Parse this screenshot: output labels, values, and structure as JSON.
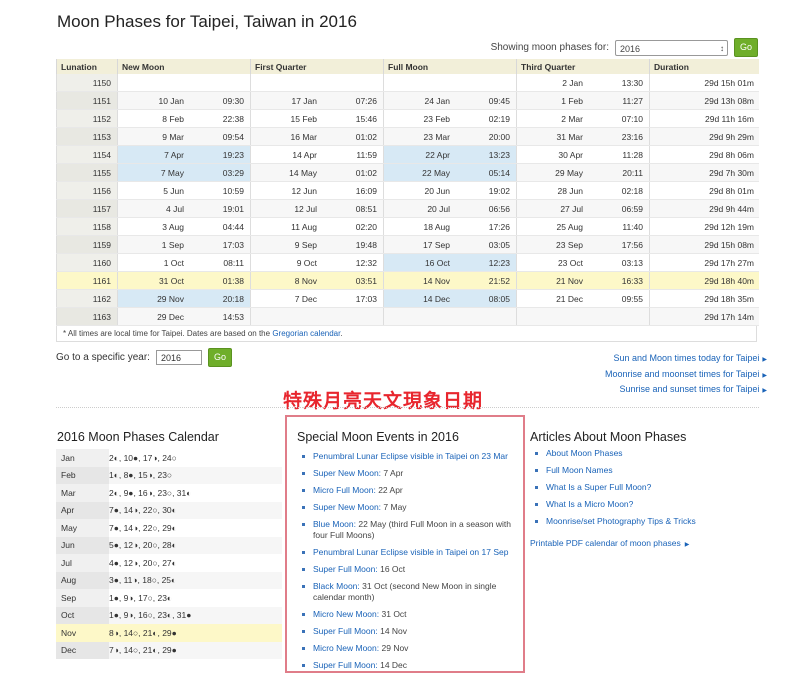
{
  "title": "Moon Phases for Taipei, Taiwan in 2016",
  "selector": {
    "label": "Showing moon phases for:",
    "value": "2016",
    "go": "Go"
  },
  "table": {
    "headers": [
      "Lunation",
      "New Moon",
      "First Quarter",
      "Full Moon",
      "Third Quarter",
      "Duration"
    ],
    "rows": [
      {
        "lun": "1150",
        "nm": [
          "",
          ""
        ],
        "fq": [
          "",
          ""
        ],
        "fm": [
          "",
          ""
        ],
        "tq": [
          "2 Jan",
          "13:30"
        ],
        "dur": "29d 15h 01m"
      },
      {
        "lun": "1151",
        "nm": [
          "10 Jan",
          "09:30"
        ],
        "fq": [
          "17 Jan",
          "07:26"
        ],
        "fm": [
          "24 Jan",
          "09:45"
        ],
        "tq": [
          "1 Feb",
          "11:27"
        ],
        "dur": "29d 13h 08m"
      },
      {
        "lun": "1152",
        "nm": [
          "8 Feb",
          "22:38"
        ],
        "fq": [
          "15 Feb",
          "15:46"
        ],
        "fm": [
          "23 Feb",
          "02:19"
        ],
        "tq": [
          "2 Mar",
          "07:10"
        ],
        "dur": "29d 11h 16m"
      },
      {
        "lun": "1153",
        "nm": [
          "9 Mar",
          "09:54"
        ],
        "fq": [
          "16 Mar",
          "01:02"
        ],
        "fm": [
          "23 Mar",
          "20:00"
        ],
        "tq": [
          "31 Mar",
          "23:16"
        ],
        "dur": "29d 9h 29m"
      },
      {
        "lun": "1154",
        "nm": [
          "7 Apr",
          "19:23"
        ],
        "fq": [
          "14 Apr",
          "11:59"
        ],
        "fm": [
          "22 Apr",
          "13:23"
        ],
        "tq": [
          "30 Apr",
          "11:28"
        ],
        "dur": "29d 8h 06m"
      },
      {
        "lun": "1155",
        "nm": [
          "7 May",
          "03:29"
        ],
        "fq": [
          "14 May",
          "01:02"
        ],
        "fm": [
          "22 May",
          "05:14"
        ],
        "tq": [
          "29 May",
          "20:11"
        ],
        "dur": "29d 7h 30m"
      },
      {
        "lun": "1156",
        "nm": [
          "5 Jun",
          "10:59"
        ],
        "fq": [
          "12 Jun",
          "16:09"
        ],
        "fm": [
          "20 Jun",
          "19:02"
        ],
        "tq": [
          "28 Jun",
          "02:18"
        ],
        "dur": "29d 8h 01m"
      },
      {
        "lun": "1157",
        "nm": [
          "4 Jul",
          "19:01"
        ],
        "fq": [
          "12 Jul",
          "08:51"
        ],
        "fm": [
          "20 Jul",
          "06:56"
        ],
        "tq": [
          "27 Jul",
          "06:59"
        ],
        "dur": "29d 9h 44m"
      },
      {
        "lun": "1158",
        "nm": [
          "3 Aug",
          "04:44"
        ],
        "fq": [
          "11 Aug",
          "02:20"
        ],
        "fm": [
          "18 Aug",
          "17:26"
        ],
        "tq": [
          "25 Aug",
          "11:40"
        ],
        "dur": "29d 12h 19m"
      },
      {
        "lun": "1159",
        "nm": [
          "1 Sep",
          "17:03"
        ],
        "fq": [
          "9 Sep",
          "19:48"
        ],
        "fm": [
          "17 Sep",
          "03:05"
        ],
        "tq": [
          "23 Sep",
          "17:56"
        ],
        "dur": "29d 15h 08m"
      },
      {
        "lun": "1160",
        "nm": [
          "1 Oct",
          "08:11"
        ],
        "fq": [
          "9 Oct",
          "12:32"
        ],
        "fm": [
          "16 Oct",
          "12:23"
        ],
        "tq": [
          "23 Oct",
          "03:13"
        ],
        "dur": "29d 17h 27m"
      },
      {
        "lun": "1161",
        "nm": [
          "31 Oct",
          "01:38"
        ],
        "fq": [
          "8 Nov",
          "03:51"
        ],
        "fm": [
          "14 Nov",
          "21:52"
        ],
        "tq": [
          "21 Nov",
          "16:33"
        ],
        "dur": "29d 18h 40m"
      },
      {
        "lun": "1162",
        "nm": [
          "29 Nov",
          "20:18"
        ],
        "fq": [
          "7 Dec",
          "17:03"
        ],
        "fm": [
          "14 Dec",
          "08:05"
        ],
        "tq": [
          "21 Dec",
          "09:55"
        ],
        "dur": "29d 18h 35m"
      },
      {
        "lun": "1163",
        "nm": [
          "29 Dec",
          "14:53"
        ],
        "fq": [
          "",
          ""
        ],
        "fm": [
          "",
          ""
        ],
        "tq": [
          "",
          ""
        ],
        "dur": "29d 17h 14m"
      }
    ]
  },
  "footnote": {
    "text": "* All times are local time for Taipei. Dates are based on the",
    "link": "Gregorian calendar",
    "end": "."
  },
  "goto": {
    "label": "Go to a specific year:",
    "value": "2016",
    "go": "Go"
  },
  "side_links": [
    "Sun and Moon times today for Taipei",
    "Moonrise and moonset times for Taipei",
    "Sunrise and sunset times for Taipei"
  ],
  "annotation": "特殊月亮天文現象日期",
  "calendar": {
    "title": "2016 Moon Phases Calendar",
    "rows": [
      {
        "month": "Jan",
        "text": "2◐, 10●, 17◑, 24○"
      },
      {
        "month": "Feb",
        "text": "1◐, 8●, 15◑, 23○"
      },
      {
        "month": "Mar",
        "text": "2◐, 9●, 16◑, 23○, 31◐"
      },
      {
        "month": "Apr",
        "text": "7●, 14◑, 22○, 30◐"
      },
      {
        "month": "May",
        "text": "7●, 14◑, 22○, 29◐"
      },
      {
        "month": "Jun",
        "text": "5●, 12◑, 20○, 28◐"
      },
      {
        "month": "Jul",
        "text": "4●, 12◑, 20○, 27◐"
      },
      {
        "month": "Aug",
        "text": "3●, 11◑, 18○, 25◐"
      },
      {
        "month": "Sep",
        "text": "1●, 9◑, 17○, 23◐"
      },
      {
        "month": "Oct",
        "text": "1●, 9◑, 16○, 23◐, 31●"
      },
      {
        "month": "Nov",
        "text": "8◑, 14○, 21◐, 29●"
      },
      {
        "month": "Dec",
        "text": "7◑, 14○, 21◐, 29●"
      }
    ]
  },
  "events": {
    "title": "Special Moon Events in 2016",
    "items": [
      {
        "link": "Penumbral Lunar Eclipse visible in Taipei on 23 Mar",
        "rest": ""
      },
      {
        "link": "Super New Moon:",
        "rest": " 7 Apr"
      },
      {
        "link": "Micro Full Moon:",
        "rest": " 22 Apr"
      },
      {
        "link": "Super New Moon:",
        "rest": " 7 May"
      },
      {
        "link": "Blue Moon:",
        "rest": " 22 May (third Full Moon in a season with four Full Moons)"
      },
      {
        "link": "Penumbral Lunar Eclipse visible in Taipei on 17 Sep",
        "rest": ""
      },
      {
        "link": "Super Full Moon:",
        "rest": " 16 Oct"
      },
      {
        "link": "Black Moon:",
        "rest": " 31 Oct (second New Moon in single calendar month)"
      },
      {
        "link": "Micro New Moon:",
        "rest": " 31 Oct"
      },
      {
        "link": "Super Full Moon:",
        "rest": " 14 Nov"
      },
      {
        "link": "Micro New Moon:",
        "rest": " 29 Nov"
      },
      {
        "link": "Super Full Moon:",
        "rest": " 14 Dec"
      }
    ]
  },
  "articles": {
    "title": "Articles About Moon Phases",
    "items": [
      "About Moon Phases",
      "Full Moon Names",
      "What Is a Super Full Moon?",
      "What Is a Micro Moon?",
      "Moonrise/set Photography Tips & Tricks"
    ],
    "pdf": "Printable PDF calendar of moon phases"
  }
}
